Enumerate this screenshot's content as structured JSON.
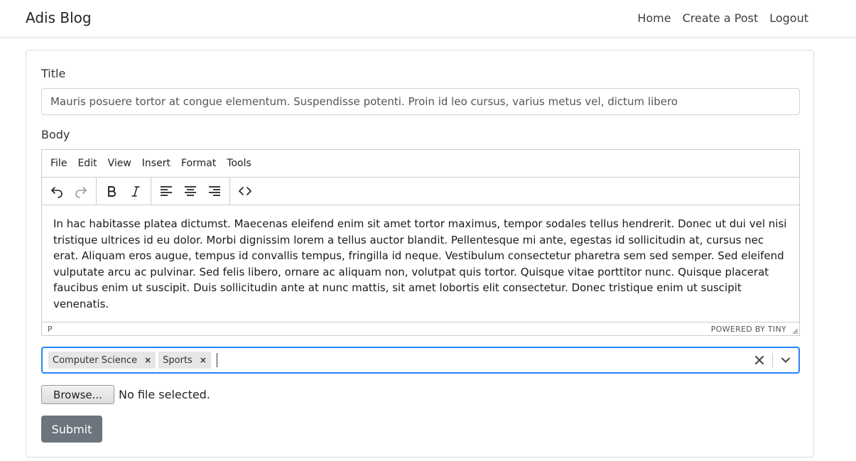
{
  "navbar": {
    "brand": "Adis Blog",
    "links": [
      "Home",
      "Create a Post",
      "Logout"
    ]
  },
  "form": {
    "title_label": "Title",
    "title_value": "Mauris posuere tortor at congue elementum. Suspendisse potenti. Proin id leo cursus, varius metus vel, dictum libero",
    "body_label": "Body",
    "editor": {
      "menu": [
        "File",
        "Edit",
        "View",
        "Insert",
        "Format",
        "Tools"
      ],
      "toolbar_icons": [
        "undo-icon",
        "redo-icon",
        "bold-icon",
        "italic-icon",
        "align-left-icon",
        "align-center-icon",
        "align-right-icon",
        "code-icon"
      ],
      "content": "In hac habitasse platea dictumst. Maecenas eleifend enim sit amet tortor maximus, tempor sodales tellus hendrerit. Donec ut dui vel nisi tristique ultrices id eu dolor. Morbi dignissim lorem a tellus auctor blandit. Pellentesque mi ante, egestas id sollicitudin at, cursus nec erat. Aliquam eros augue, tempus id convallis tempus, fringilla id neque. Vestibulum consectetur pharetra sem sed semper. Sed eleifend vulputate arcu ac pulvinar. Sed felis libero, ornare ac aliquam non, volutpat quis tortor. Quisque vitae porttitor nunc. Quisque placerat faucibus enim ut suscipit. Duis sollicitudin ante at nunc mattis, sit amet lobortis elit consectetur. Donec tristique enim ut suscipit venenatis.",
      "status_path": "P",
      "powered_by": "POWERED BY TINY"
    },
    "tags": [
      "Computer Science",
      "Sports"
    ],
    "tag_remove_glyph": "×",
    "file": {
      "button_label": "Browse...",
      "status": "No file selected."
    },
    "submit_label": "Submit"
  },
  "colors": {
    "focus_border": "#2684ff",
    "submit_bg": "#6c757d",
    "chip_bg": "#e6e6e6"
  }
}
